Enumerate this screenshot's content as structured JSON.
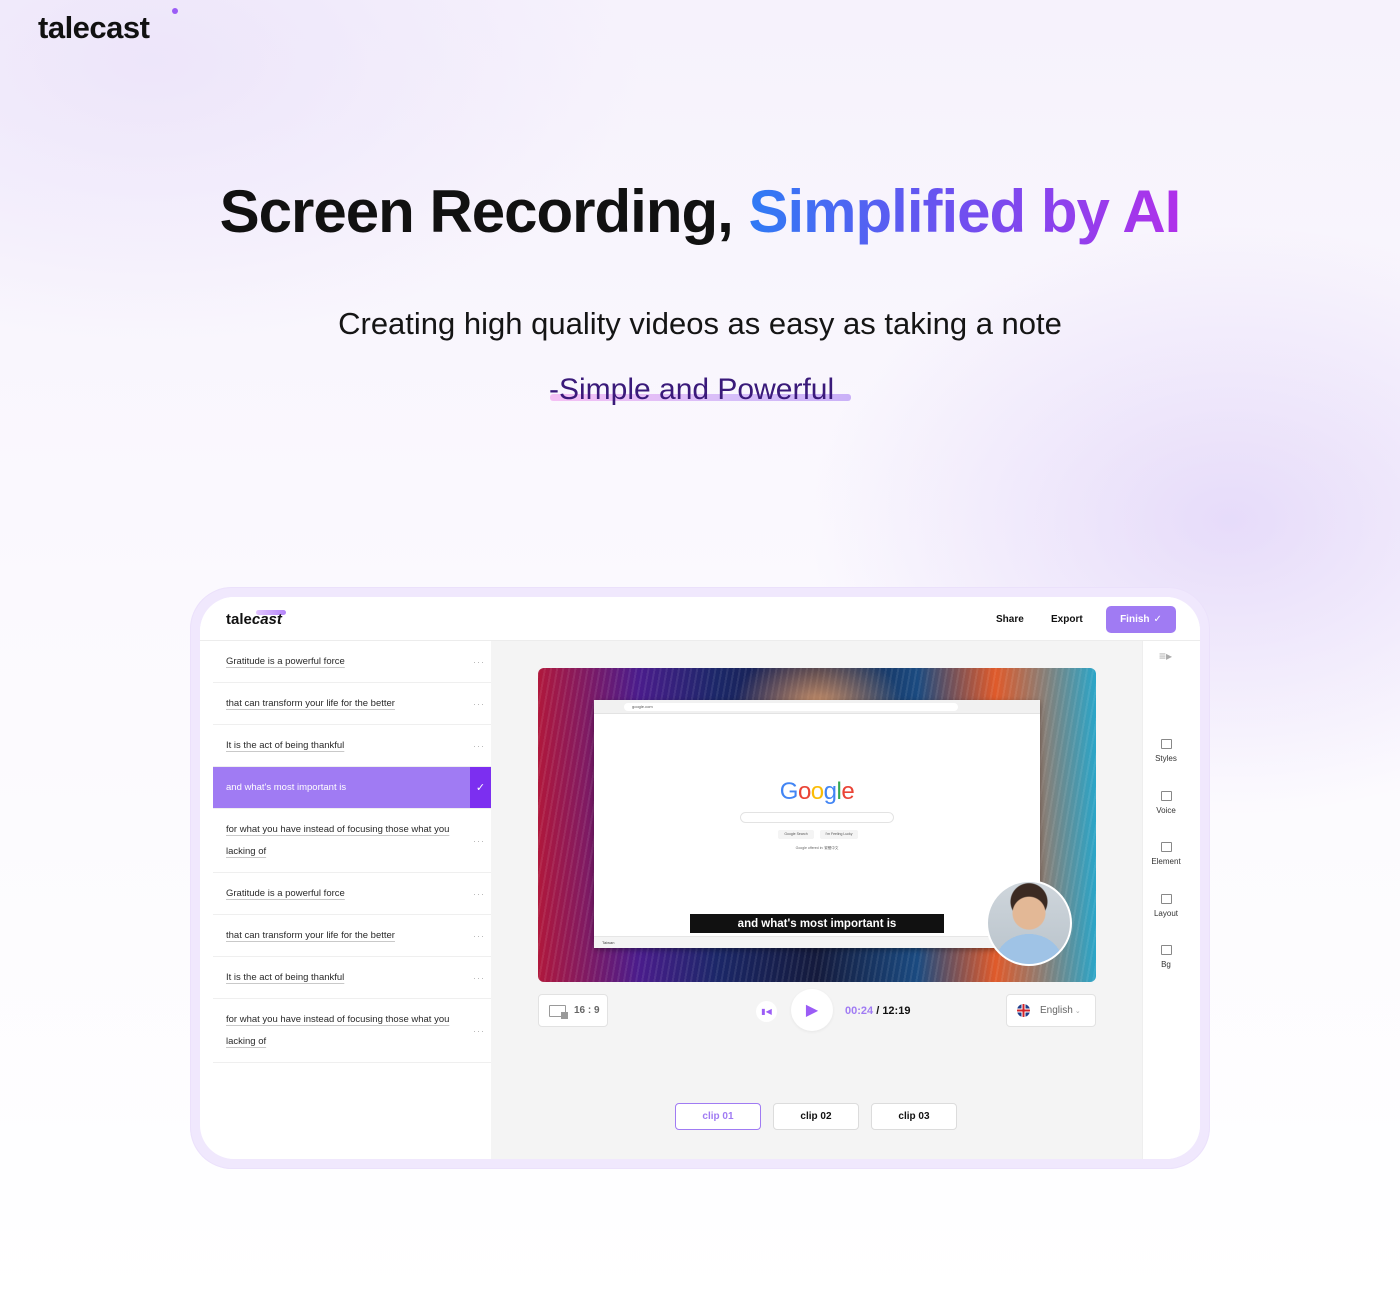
{
  "brand": {
    "name": "talecast",
    "accent": "#9b5cf6"
  },
  "hero": {
    "title_plain": "Screen Recording,",
    "title_gradient": "Simplified by AI",
    "subtitle": "Creating high quality videos as easy as taking a note",
    "tagline": "-Simple and Powerful"
  },
  "app": {
    "logo_plain": "tale",
    "logo_italic": "cast",
    "nav": {
      "share": "Share",
      "export": "Export",
      "finish": "Finish",
      "finish_icon": "check-icon"
    },
    "transcript": [
      {
        "text": "Gratitude is a powerful force",
        "active": false
      },
      {
        "text": "that can transform your life for the better",
        "active": false
      },
      {
        "text": "It is the act of being thankful",
        "active": false
      },
      {
        "text": "and what's most important is",
        "active": true
      },
      {
        "text": "for what you have instead of focusing those what you lacking of",
        "active": false
      },
      {
        "text": "Gratitude is a powerful force",
        "active": false
      },
      {
        "text": "that can transform your life for the better",
        "active": false
      },
      {
        "text": "It is the act of being thankful",
        "active": false
      },
      {
        "text": "for what you have instead of focusing those what you lacking of",
        "active": false
      }
    ],
    "video": {
      "browser_url": "google.com",
      "google_logo": "Google",
      "google_search_btn": "Google Search",
      "feeling_lucky_btn": "I'm Feeling Lucky",
      "offered_in": "Google offered in: 繁體中文",
      "footer": "Taiwan",
      "caption": "and what's most important is"
    },
    "controls": {
      "aspect_ratio": "16 : 9",
      "current_time": "00:24",
      "total_time": "12:19",
      "time_sep": " / ",
      "language": "English"
    },
    "clips": [
      {
        "label": "clip 01",
        "active": true
      },
      {
        "label": "clip 02",
        "active": false
      },
      {
        "label": "clip 03",
        "active": false
      }
    ],
    "side_panel": [
      {
        "label": "Styles"
      },
      {
        "label": "Voice"
      },
      {
        "label": "Element"
      },
      {
        "label": "Layout"
      },
      {
        "label": "Bg"
      }
    ]
  }
}
